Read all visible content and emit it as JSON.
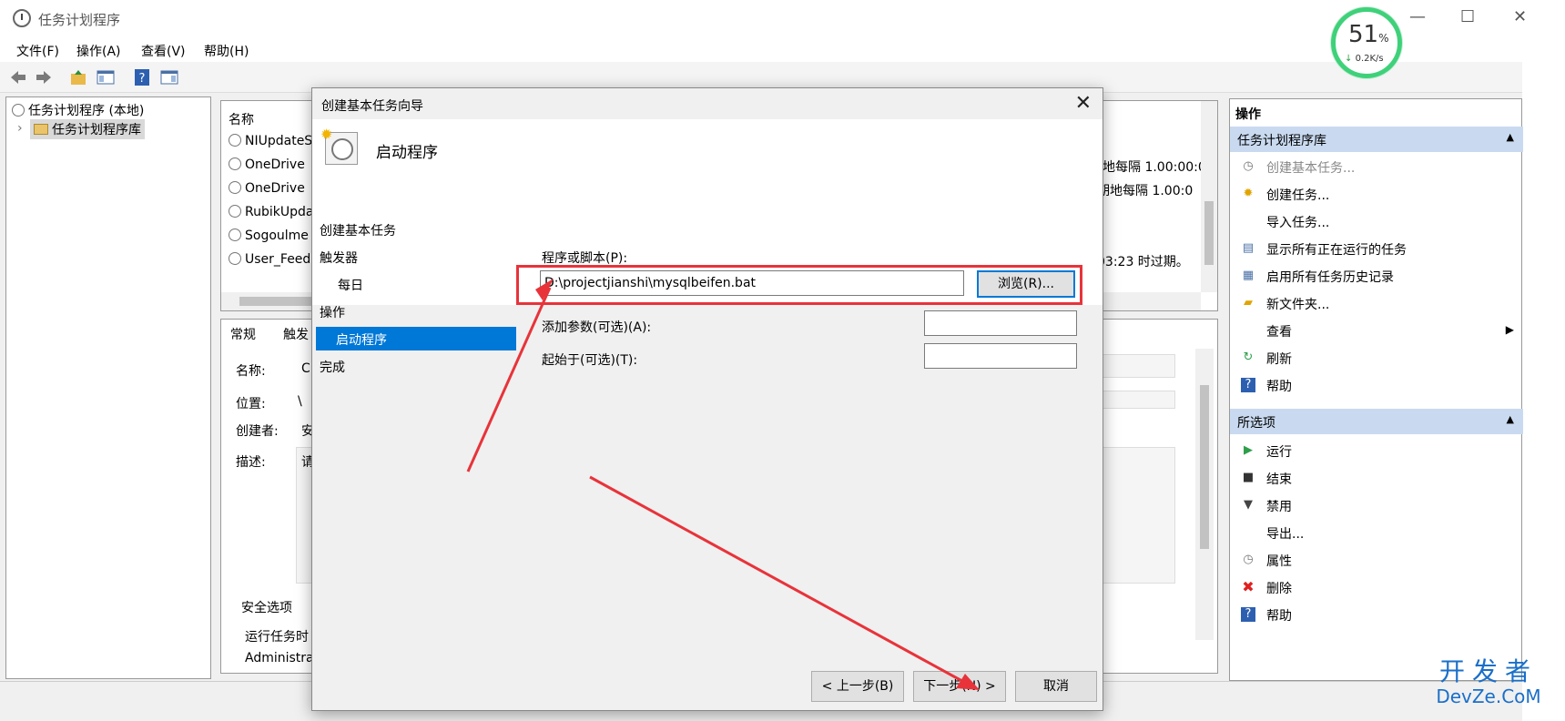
{
  "window": {
    "title": "任务计划程序",
    "minimize": "—",
    "maximize": "☐",
    "close": "✕"
  },
  "menu": [
    "文件(F)",
    "操作(A)",
    "查看(V)",
    "帮助(H)"
  ],
  "network_widget": {
    "percent": "51",
    "percent_unit": "%",
    "speed": "0.2K/s",
    "speed_arrow": "↓"
  },
  "tree": {
    "root": "任务计划程序 (本地)",
    "child": "任务计划程序库"
  },
  "task_list": {
    "column": "名称",
    "rows": [
      {
        "name": "NIUpdateS",
        "trigger": ""
      },
      {
        "name": "OneDrive",
        "trigger": "地每隔 1.00:00:0"
      },
      {
        "name": "OneDrive",
        "trigger": "期地每隔 1.00:0"
      },
      {
        "name": "RubikUpda",
        "trigger": ""
      },
      {
        "name": "Sogoulme",
        "trigger": ""
      },
      {
        "name": "User_Feed",
        "trigger": "03:23 时过期。"
      }
    ]
  },
  "properties": {
    "tabs": [
      "常规",
      "触发"
    ],
    "labels": [
      "名称:",
      "位置:",
      "创建者:",
      "描述:"
    ],
    "values": [
      "C",
      "\\",
      "安",
      "请"
    ],
    "security_section": "安全选项",
    "security_line": "运行任务时",
    "account": "Administra"
  },
  "right_pane": {
    "title": "操作",
    "section1": "任务计划程序库",
    "items1": [
      {
        "icon": "create-basic-task-icon",
        "glyph": "◷",
        "label": "创建基本任务...",
        "disabled": true
      },
      {
        "icon": "create-task-icon",
        "glyph": "✹",
        "label": "创建任务...",
        "disabled": false
      },
      {
        "icon": "",
        "glyph": "",
        "label": "导入任务...",
        "disabled": false
      },
      {
        "icon": "running-tasks-icon",
        "glyph": "▤",
        "label": "显示所有正在运行的任务",
        "disabled": false
      },
      {
        "icon": "history-icon",
        "glyph": "▦",
        "label": "启用所有任务历史记录",
        "disabled": false
      },
      {
        "icon": "new-folder-icon",
        "glyph": "▰",
        "label": "新文件夹...",
        "disabled": false
      },
      {
        "icon": "",
        "glyph": "",
        "label": "查看",
        "disabled": false,
        "submenu": "▶"
      },
      {
        "icon": "refresh-icon",
        "glyph": "↻",
        "label": "刷新",
        "disabled": false
      },
      {
        "icon": "help-icon",
        "glyph": "?",
        "label": "帮助",
        "disabled": false
      }
    ],
    "section2": "所选项",
    "items2": [
      {
        "icon": "run-icon",
        "glyph": "▶",
        "label": "运行"
      },
      {
        "icon": "end-icon",
        "glyph": "■",
        "label": "结束"
      },
      {
        "icon": "disable-icon",
        "glyph": "▼",
        "label": "禁用"
      },
      {
        "icon": "",
        "glyph": "",
        "label": "导出..."
      },
      {
        "icon": "properties-icon",
        "glyph": "◷",
        "label": "属性"
      },
      {
        "icon": "delete-icon",
        "glyph": "✖",
        "label": "删除"
      },
      {
        "icon": "help-icon",
        "glyph": "?",
        "label": "帮助"
      }
    ],
    "collapse_glyph": "▲"
  },
  "dialog": {
    "title": "创建基本任务向导",
    "close": "✕",
    "heading": "启动程序",
    "steps": [
      {
        "label": "创建基本任务",
        "indent": false,
        "selected": false
      },
      {
        "label": "触发器",
        "indent": false,
        "selected": false
      },
      {
        "label": "每日",
        "indent": true,
        "selected": false
      },
      {
        "label": "操作",
        "indent": false,
        "selected": false
      },
      {
        "label": "启动程序",
        "indent": true,
        "selected": true
      },
      {
        "label": "完成",
        "indent": false,
        "selected": false
      }
    ],
    "program_label": "程序或脚本(P):",
    "program_value": "D:\\projectjianshi\\mysqlbeifen.bat",
    "browse": "浏览(R)...",
    "args_label": "添加参数(可选)(A):",
    "args_value": "",
    "start_in_label": "起始于(可选)(T):",
    "start_in_value": "",
    "back": "< 上一步(B)",
    "next": "下一步(N) >",
    "cancel": "取消"
  },
  "watermark": {
    "line1": "开发者",
    "line2": "DevZe.CoM"
  },
  "colors": {
    "accent": "#0078d7",
    "annotation_red": "#e8333a",
    "pane_header": "#c9daf0",
    "net_green": "#3fd17a"
  }
}
